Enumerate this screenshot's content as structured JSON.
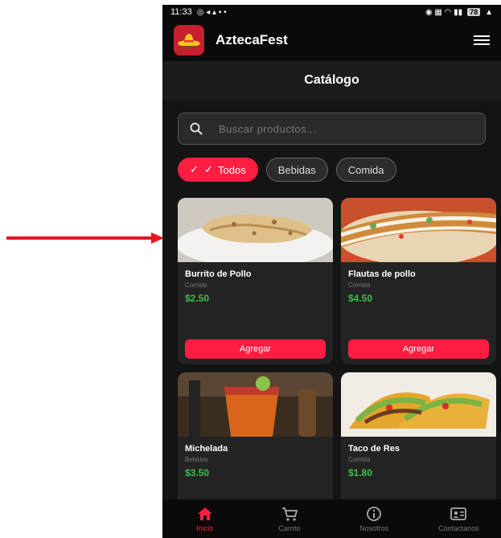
{
  "status_bar": {
    "time": "11:33",
    "battery": "78"
  },
  "app": {
    "title": "AztecaFest"
  },
  "page": {
    "title": "Catálogo"
  },
  "search": {
    "placeholder": "Buscar productos..."
  },
  "filters": [
    {
      "label": "Todos",
      "active": true
    },
    {
      "label": "Bebidas",
      "active": false
    },
    {
      "label": "Comida",
      "active": false
    }
  ],
  "products": [
    {
      "name": "Burrito de Pollo",
      "category": "Comida",
      "price": "$2.50",
      "button": "Agregar"
    },
    {
      "name": "Flautas de pollo",
      "category": "Comida",
      "price": "$4.50",
      "button": "Agregar"
    },
    {
      "name": "Michelada",
      "category": "Bebidas",
      "price": "$3.50"
    },
    {
      "name": "Taco de Res",
      "category": "Comida",
      "price": "$1.80"
    }
  ],
  "bottom_nav": [
    {
      "label": "Inicio",
      "icon": "home-icon",
      "active": true
    },
    {
      "label": "Carrito",
      "icon": "cart-icon"
    },
    {
      "label": "Nosotros",
      "icon": "info-icon"
    },
    {
      "label": "Contactanos",
      "icon": "contact-card-icon"
    }
  ],
  "colors": {
    "accent": "#ff1d42",
    "price": "#3cc04a",
    "background": "#141414",
    "annotation_arrow": "#e8141e"
  }
}
